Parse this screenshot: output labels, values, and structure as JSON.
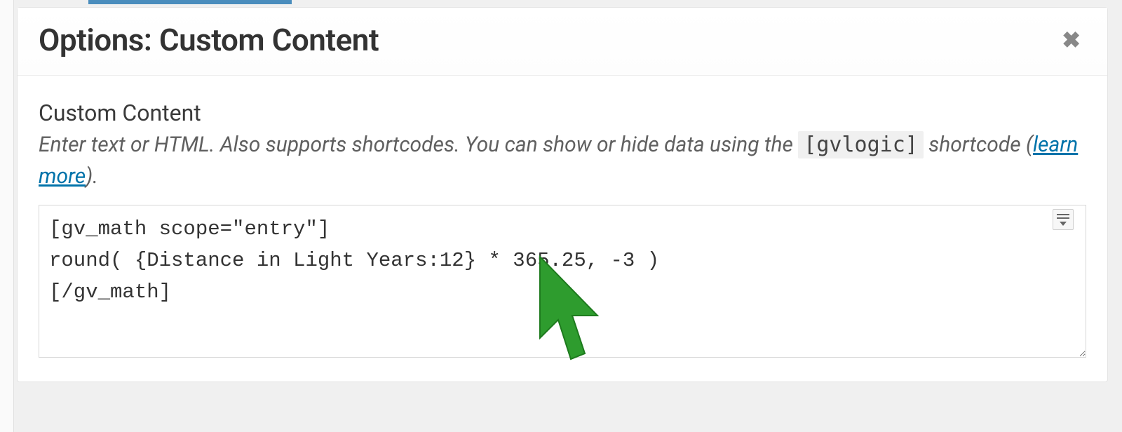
{
  "dialog": {
    "title": "Options: Custom Content",
    "close_icon": "✖"
  },
  "field": {
    "label": "Custom Content",
    "help_before": "Enter text or HTML. Also supports shortcodes. You can show or hide data using the ",
    "help_code": "[gvlogic]",
    "help_mid": " shortcode (",
    "help_link": "learn more",
    "help_after": ")."
  },
  "textarea": {
    "value": "[gv_math scope=\"entry\"]\nround( {Distance in Light Years:12} * 365.25, -3 )\n[/gv_math]"
  }
}
